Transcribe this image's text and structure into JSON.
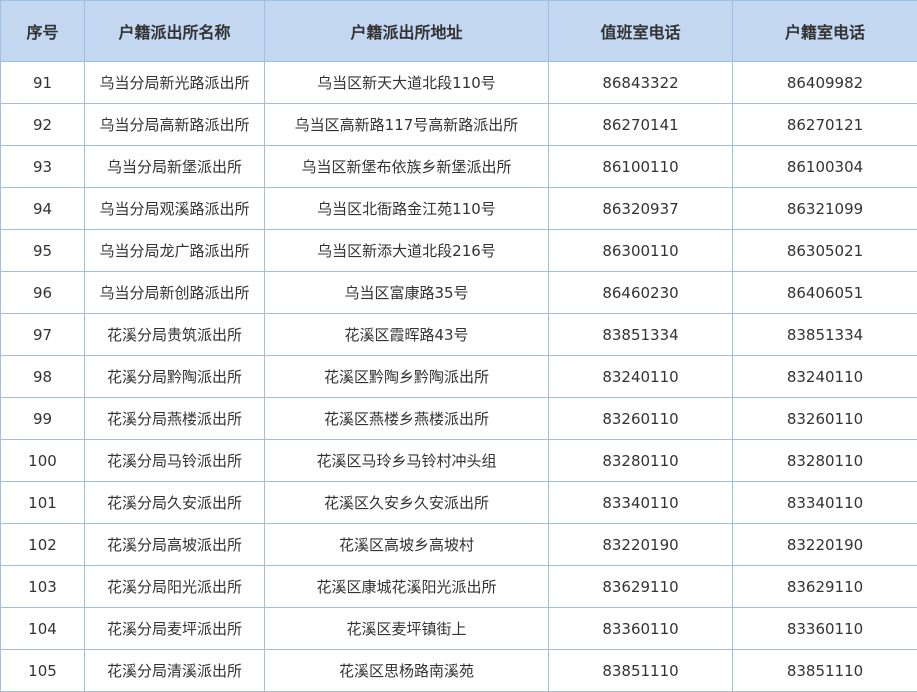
{
  "colors": {
    "header_bg": "#c3d7f1",
    "border": "#9fbfe3",
    "text": "#333333"
  },
  "headers": {
    "no": "序号",
    "name": "户籍派出所名称",
    "address": "户籍派出所地址",
    "duty_phone": "值班室电话",
    "registry_phone": "户籍室电话"
  },
  "rows": [
    {
      "no": "91",
      "name": "乌当分局新光路派出所",
      "address": "乌当区新天大道北段110号",
      "duty_phone": "86843322",
      "registry_phone": "86409982"
    },
    {
      "no": "92",
      "name": "乌当分局高新路派出所",
      "address": "乌当区高新路117号高新路派出所",
      "duty_phone": "86270141",
      "registry_phone": "86270121"
    },
    {
      "no": "93",
      "name": "乌当分局新堡派出所",
      "address": "乌当区新堡布依族乡新堡派出所",
      "duty_phone": "86100110",
      "registry_phone": "86100304"
    },
    {
      "no": "94",
      "name": "乌当分局观溪路派出所",
      "address": "乌当区北衙路金江苑110号",
      "duty_phone": "86320937",
      "registry_phone": "86321099"
    },
    {
      "no": "95",
      "name": "乌当分局龙广路派出所",
      "address": "乌当区新添大道北段216号",
      "duty_phone": "86300110",
      "registry_phone": "86305021"
    },
    {
      "no": "96",
      "name": "乌当分局新创路派出所",
      "address": "乌当区富康路35号",
      "duty_phone": "86460230",
      "registry_phone": "86406051"
    },
    {
      "no": "97",
      "name": "花溪分局贵筑派出所",
      "address": "花溪区霞晖路43号",
      "duty_phone": "83851334",
      "registry_phone": "83851334"
    },
    {
      "no": "98",
      "name": "花溪分局黔陶派出所",
      "address": "花溪区黔陶乡黔陶派出所",
      "duty_phone": "83240110",
      "registry_phone": "83240110"
    },
    {
      "no": "99",
      "name": "花溪分局燕楼派出所",
      "address": "花溪区燕楼乡燕楼派出所",
      "duty_phone": "83260110",
      "registry_phone": "83260110"
    },
    {
      "no": "100",
      "name": "花溪分局马铃派出所",
      "address": "花溪区马玲乡马铃村冲头组",
      "duty_phone": "83280110",
      "registry_phone": "83280110"
    },
    {
      "no": "101",
      "name": "花溪分局久安派出所",
      "address": "花溪区久安乡久安派出所",
      "duty_phone": "83340110",
      "registry_phone": "83340110"
    },
    {
      "no": "102",
      "name": "花溪分局高坡派出所",
      "address": "花溪区高坡乡高坡村",
      "duty_phone": "83220190",
      "registry_phone": "83220190"
    },
    {
      "no": "103",
      "name": "花溪分局阳光派出所",
      "address": "花溪区康城花溪阳光派出所",
      "duty_phone": "83629110",
      "registry_phone": "83629110"
    },
    {
      "no": "104",
      "name": "花溪分局麦坪派出所",
      "address": "花溪区麦坪镇街上",
      "duty_phone": "83360110",
      "registry_phone": "83360110"
    },
    {
      "no": "105",
      "name": "花溪分局清溪派出所",
      "address": "花溪区思杨路南溪苑",
      "duty_phone": "83851110",
      "registry_phone": "83851110"
    }
  ]
}
